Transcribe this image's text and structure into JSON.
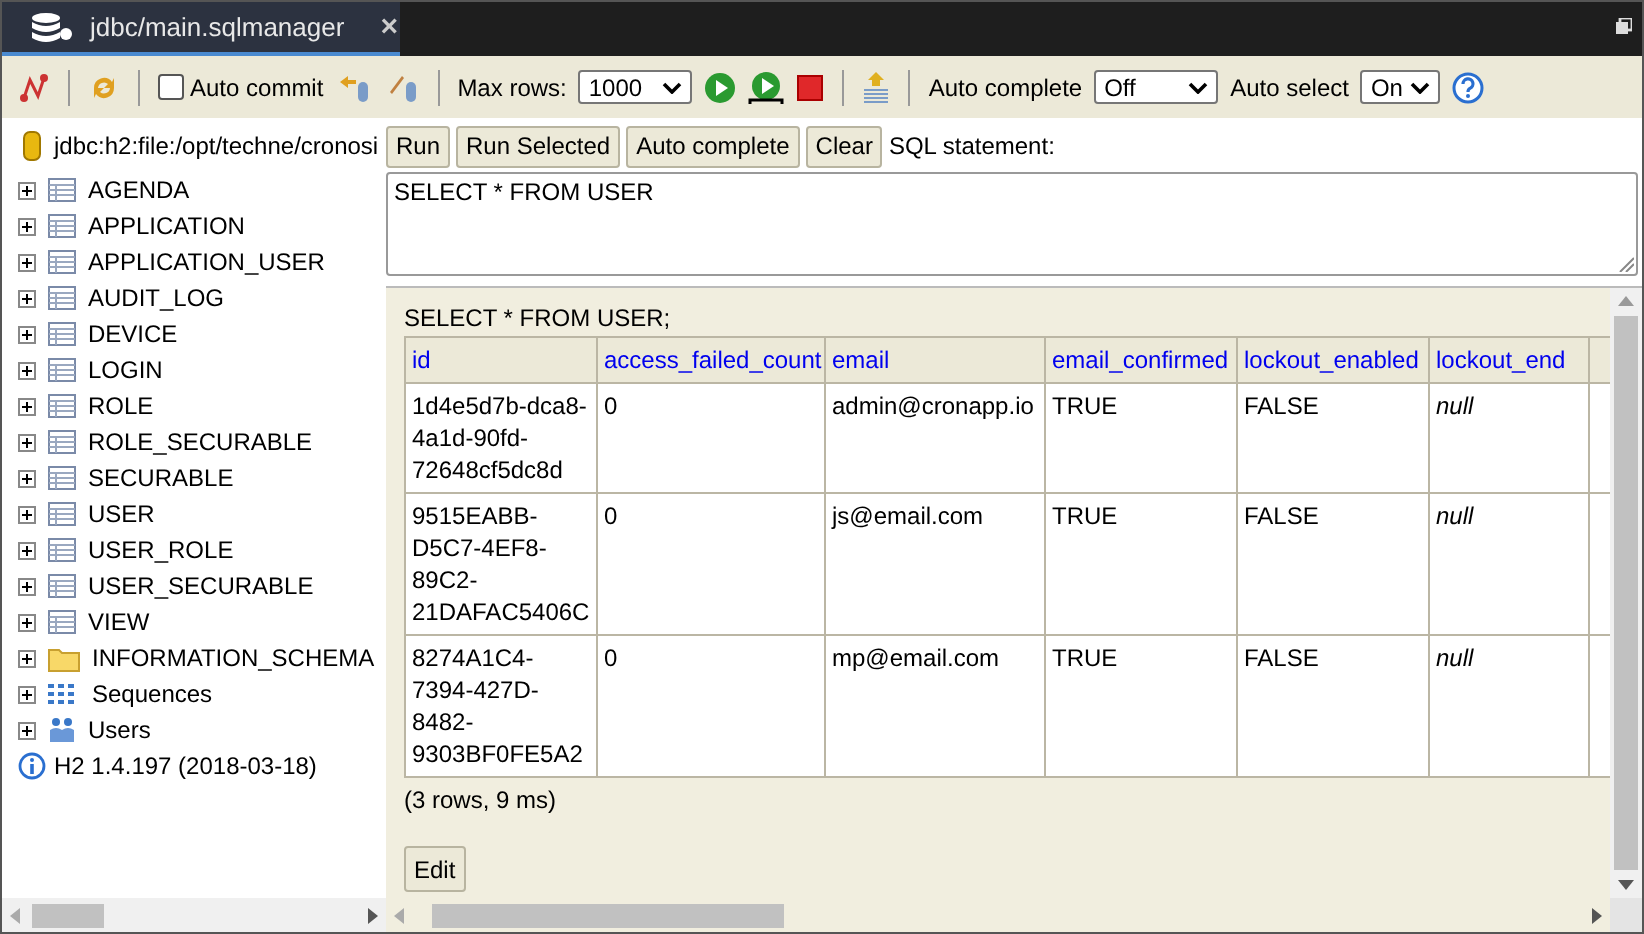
{
  "tab": {
    "title": "jdbc/main.sqlmanager",
    "close": "×"
  },
  "toolbar": {
    "auto_commit": {
      "label": "Auto commit",
      "checked": false
    },
    "max_rows": {
      "label": "Max rows:",
      "value": "1000"
    },
    "auto_complete": {
      "label": "Auto complete",
      "value": "Off"
    },
    "auto_select": {
      "label": "Auto select",
      "value": "On"
    }
  },
  "connection": "jdbc:h2:file:/opt/techne/cronosi",
  "query_buttons": [
    "Run",
    "Run Selected",
    "Auto complete",
    "Clear"
  ],
  "sql_label": "SQL statement:",
  "sql": "SELECT * FROM USER",
  "tree": [
    {
      "label": "AGENDA",
      "kind": "table"
    },
    {
      "label": "APPLICATION",
      "kind": "table"
    },
    {
      "label": "APPLICATION_USER",
      "kind": "table"
    },
    {
      "label": "AUDIT_LOG",
      "kind": "table"
    },
    {
      "label": "DEVICE",
      "kind": "table"
    },
    {
      "label": "LOGIN",
      "kind": "table"
    },
    {
      "label": "ROLE",
      "kind": "table"
    },
    {
      "label": "ROLE_SECURABLE",
      "kind": "table"
    },
    {
      "label": "SECURABLE",
      "kind": "table"
    },
    {
      "label": "USER",
      "kind": "table"
    },
    {
      "label": "USER_ROLE",
      "kind": "table"
    },
    {
      "label": "USER_SECURABLE",
      "kind": "table"
    },
    {
      "label": "VIEW",
      "kind": "table"
    },
    {
      "label": "INFORMATION_SCHEMA",
      "kind": "folder"
    },
    {
      "label": "Sequences",
      "kind": "sequences"
    },
    {
      "label": "Users",
      "kind": "users"
    }
  ],
  "version": "H2 1.4.197 (2018-03-18)",
  "result": {
    "query": "SELECT * FROM USER;",
    "columns": [
      "id",
      "access_failed_count",
      "email",
      "email_confirmed",
      "lockout_enabled",
      "lockout_end"
    ],
    "rows": [
      [
        {
          "text": "1d4e5d7b-dca8-4a1d-90fd-72648cf5dc8d",
          "null": false
        },
        {
          "text": "0",
          "null": false
        },
        {
          "text": "admin@cronapp.io",
          "null": false
        },
        {
          "text": "TRUE",
          "null": false
        },
        {
          "text": "FALSE",
          "null": false
        },
        {
          "text": "null",
          "null": true
        }
      ],
      [
        {
          "text": "9515EABB-D5C7-4EF8-89C2-21DAFAC5406C",
          "null": false
        },
        {
          "text": "0",
          "null": false
        },
        {
          "text": "js@email.com",
          "null": false
        },
        {
          "text": "TRUE",
          "null": false
        },
        {
          "text": "FALSE",
          "null": false
        },
        {
          "text": "null",
          "null": true
        }
      ],
      [
        {
          "text": "8274A1C4-7394-427D-8482-9303BF0FE5A2",
          "null": false
        },
        {
          "text": "0",
          "null": false
        },
        {
          "text": "mp@email.com",
          "null": false
        },
        {
          "text": "TRUE",
          "null": false
        },
        {
          "text": "FALSE",
          "null": false
        },
        {
          "text": "null",
          "null": true
        }
      ]
    ],
    "summary": "(3 rows, 9 ms)",
    "edit_button": "Edit"
  }
}
